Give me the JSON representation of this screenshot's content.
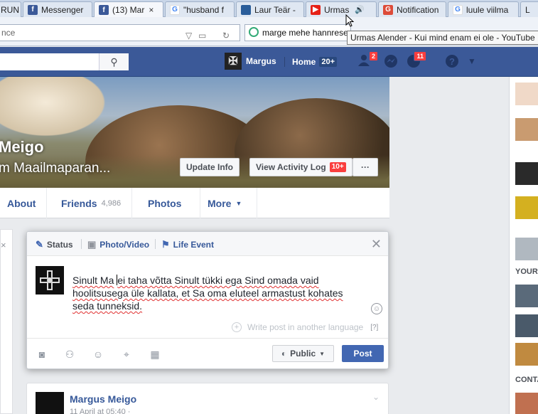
{
  "browser": {
    "tabs": [
      {
        "label": "RUN",
        "icon": "generic-tab-icon",
        "color": "#4a6fa5"
      },
      {
        "label": "Messenger",
        "icon": "facebook-icon",
        "color": "#3b5998"
      },
      {
        "label": "(13) Mar",
        "icon": "facebook-icon",
        "color": "#3b5998"
      },
      {
        "label": "\"husband f",
        "icon": "google-icon",
        "color": "#4285f4"
      },
      {
        "label": "Laur Teär -",
        "icon": "bookmark-icon",
        "color": "#2a5d9a"
      },
      {
        "label": "Urmas",
        "icon": "youtube-icon",
        "color": "#e62117"
      },
      {
        "label": "Notification",
        "icon": "google-plus-icon",
        "color": "#dd4b39"
      },
      {
        "label": "luule viilma",
        "icon": "google-icon",
        "color": "#4285f4"
      },
      {
        "label": "L",
        "icon": "generic-tab-icon",
        "color": "#888888"
      }
    ],
    "active_tab_close": "×",
    "url_text": "nce",
    "search_text": "marge mehe hannrese",
    "tooltip": "Urmas Alender - Kui mind enam ei ole - YouTube"
  },
  "fb_bar": {
    "search_placeholder": "",
    "user_name": "Margus",
    "home_label": "Home",
    "home_count": "20+",
    "friend_requests": "2",
    "notifications": "11"
  },
  "cover": {
    "name": "Meigo",
    "subtitle": "m Maailmaparan...",
    "update_info": "Update Info",
    "activity_log": "View Activity Log",
    "activity_count": "10+",
    "more_dots": "···"
  },
  "profile_nav": {
    "about": "About",
    "friends": "Friends",
    "friends_count": "4,986",
    "photos": "Photos",
    "more": "More"
  },
  "right_column": {
    "label_your": "YOUR",
    "label_conta": "CONTA"
  },
  "composer": {
    "tab_status": "Status",
    "tab_photo": "Photo/Video",
    "tab_life": "Life Event",
    "text_line1_a": "Sinult Ma",
    "text_line1_b": "ei taha võtta Sinult tükki ega Sind omada vaid",
    "text_line2": "hoolitsusega üle kallata, et Sa oma eluteel armastust kohates",
    "text_line3": "seda tunneksid.",
    "translate_label": "Write post in another language",
    "translate_help": "[?]",
    "public_label": "Public",
    "post_label": "Post"
  },
  "post": {
    "author": "Margus Meigo",
    "date": "11 April at 05:40 · "
  },
  "colors": {
    "fb_blue": "#3b5998",
    "button_blue": "#4267b2",
    "badge_red": "#fa3e3e"
  }
}
